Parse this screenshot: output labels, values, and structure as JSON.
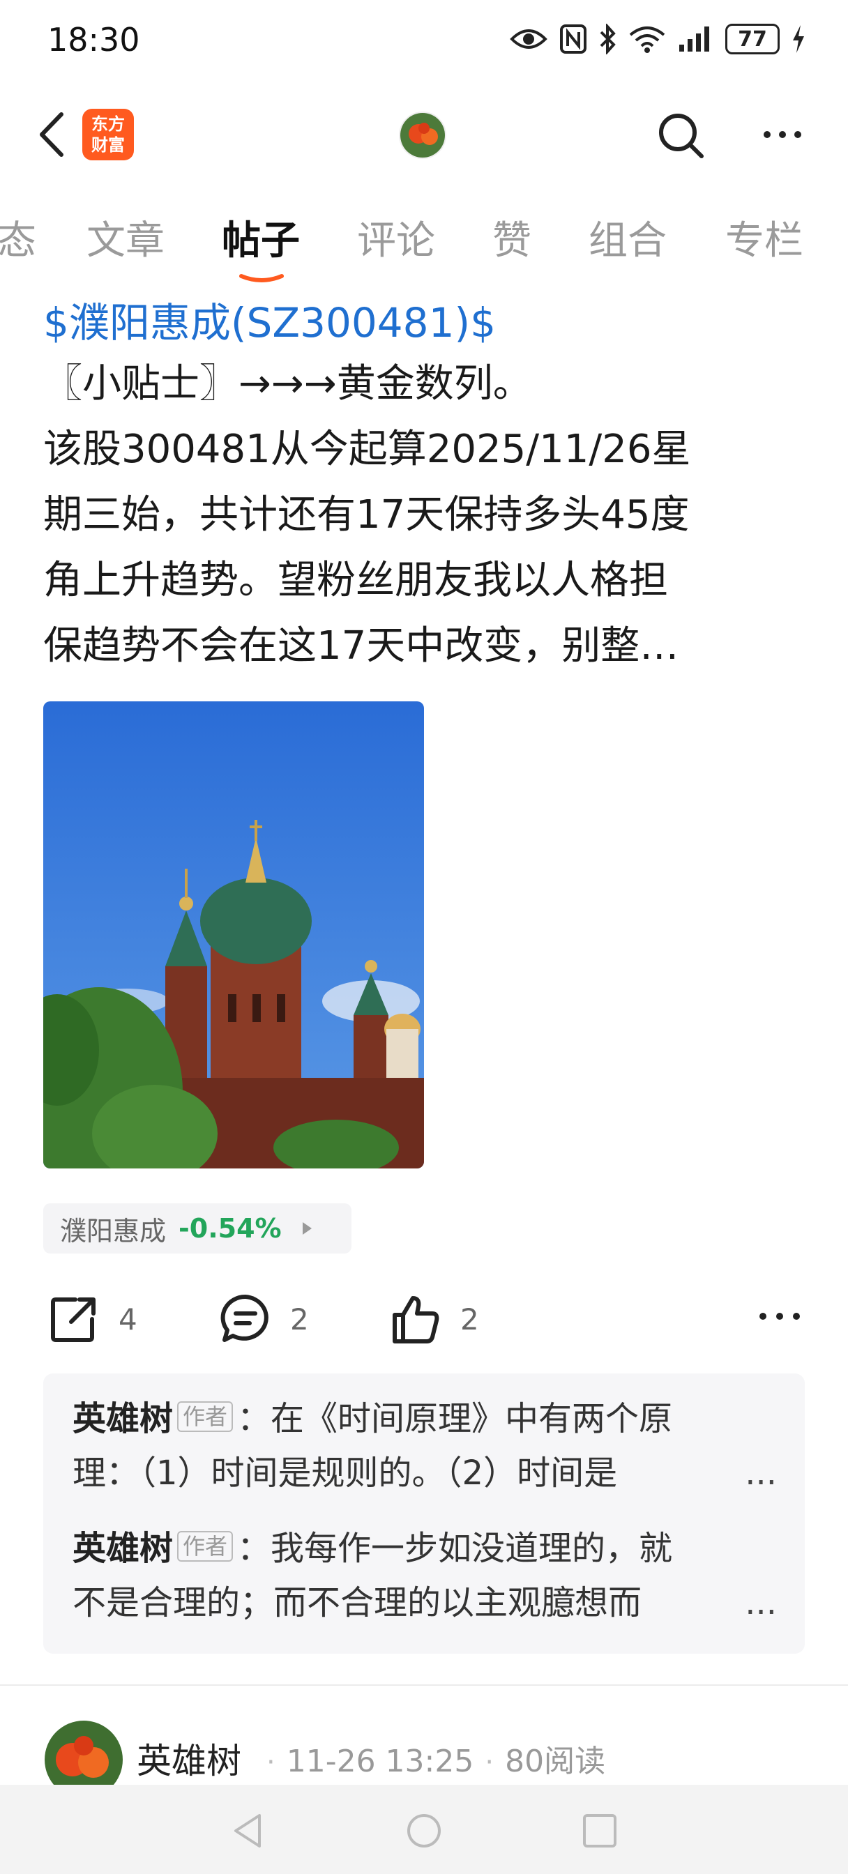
{
  "status_bar": {
    "time": "18:30",
    "battery": "77"
  },
  "app": {
    "logo_line1": "东方",
    "logo_line2": "财富"
  },
  "tabs": [
    {
      "label": "态"
    },
    {
      "label": "文章"
    },
    {
      "label": "帖子"
    },
    {
      "label": "评论"
    },
    {
      "label": "赞"
    },
    {
      "label": "组合"
    },
    {
      "label": "专栏"
    }
  ],
  "post": {
    "stock_link": "$濮阳惠成(SZ300481)$",
    "lines": [
      "〖小贴士〗→→→黄金数列。",
      "该股300481从今起算2025/11/26星",
      "期三始，共计还有17天保持多头45度",
      "角上升趋势。望粉丝朋友我以人格担",
      "保趋势不会在这17天中改变，别整…"
    ]
  },
  "stock_chip": {
    "name": "濮阳惠成",
    "change": "-0.54%"
  },
  "actions": {
    "share_count": "4",
    "comment_count": "2",
    "like_count": "2"
  },
  "comments": [
    {
      "author": "英雄树",
      "tag": "作者",
      "line1": "：在《时间原理》中有两个原",
      "line2": "理：（1）时间是规则的。（2）时间是",
      "ellipsis": "..."
    },
    {
      "author": "英雄树",
      "tag": "作者",
      "line1": "：我每作一步如没道理的，就",
      "line2": "不是合理的；而不合理的以主观臆想而",
      "ellipsis": "..."
    }
  ],
  "author": {
    "name": "英雄树",
    "date": "11-26 13:25",
    "reads": "80阅读"
  },
  "colors": {
    "accent": "#1f6fd0",
    "brand": "#ff5a1f",
    "down": "#22a55a",
    "tab_underline": "#ff5a1f"
  }
}
